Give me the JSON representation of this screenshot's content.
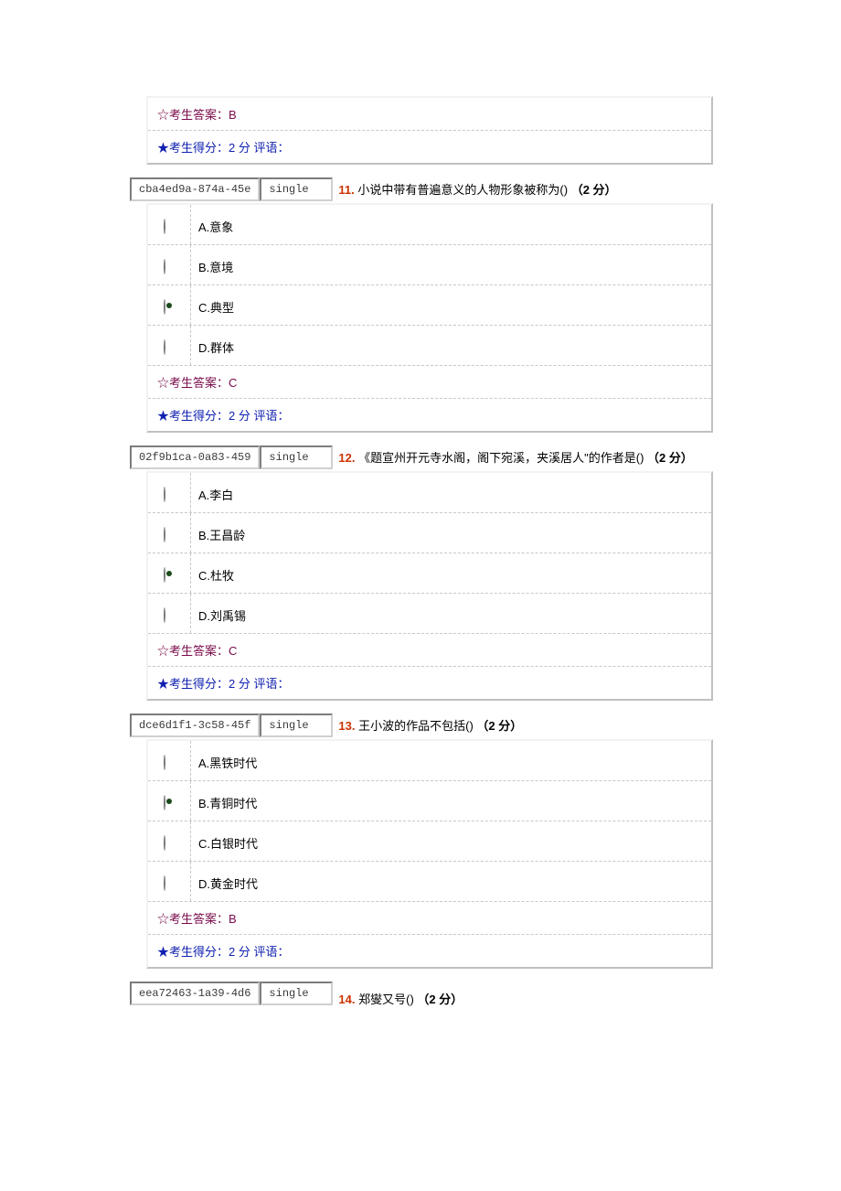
{
  "topPanel": {
    "answer_label": "☆考生答案：B",
    "score_label": "★考生得分：2 分  评语："
  },
  "q11": {
    "id1": "cba4ed9a-874a-45e",
    "id2": "single",
    "number": "11.",
    "stem": " 小说中带有普遍意义的人物形象被称为()  ",
    "points": "（2 分）",
    "options": [
      "A.意象",
      "B.意境",
      "C.典型",
      "D.群体"
    ],
    "selectedIndex": 2,
    "answer_label": "☆考生答案：C",
    "score_label": "★考生得分：2 分  评语："
  },
  "q12": {
    "id1": "02f9b1ca-0a83-459",
    "id2": "single",
    "number": "12.",
    "stem": " 《题宣州开元寺水阁，阁下宛溪，夹溪居人\"的作者是()  ",
    "points": "（2 分）",
    "options": [
      "A.李白",
      "B.王昌龄",
      "C.杜牧",
      "D.刘禹锡"
    ],
    "selectedIndex": 2,
    "answer_label": "☆考生答案：C",
    "score_label": "★考生得分：2 分  评语："
  },
  "q13": {
    "id1": "dce6d1f1-3c58-45f",
    "id2": "single",
    "number": "13.",
    "stem": " 王小波的作品不包括()  ",
    "points": "（2 分）",
    "options": [
      "A.黑铁时代",
      "B.青铜时代",
      "C.白银时代",
      "D.黄金时代"
    ],
    "selectedIndex": 1,
    "answer_label": "☆考生答案：B",
    "score_label": "★考生得分：2 分  评语："
  },
  "q14": {
    "id1": "eea72463-1a39-4d6",
    "id2": "single",
    "number": "14.",
    "stem": " 郑燮又号()  ",
    "points": "（2 分）"
  }
}
